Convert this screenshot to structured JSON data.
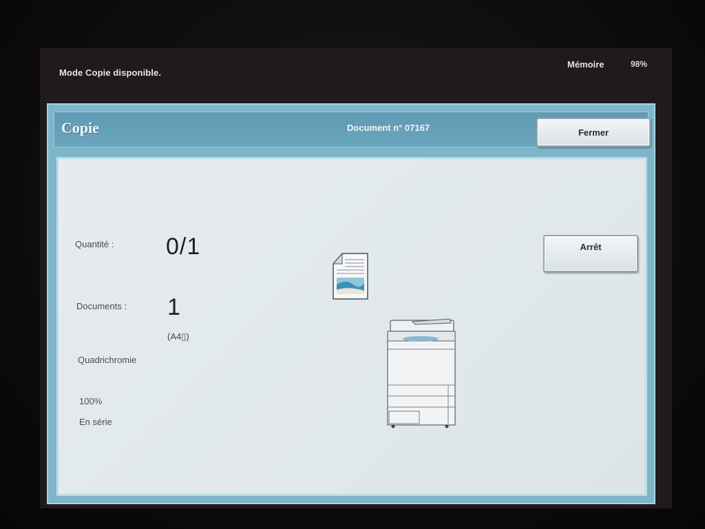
{
  "status": {
    "message": "Mode Copie disponible."
  },
  "memory": {
    "label": "Mémoire",
    "value": "98%"
  },
  "window": {
    "title": "Copie",
    "document_number": "Document n° 07167",
    "close_label": "Fermer"
  },
  "job": {
    "quantity_label": "Quantité :",
    "quantity_value": "0/1",
    "documents_label": "Documents :",
    "documents_value": "1",
    "paper_size": "(A4▯)",
    "color_mode": "Quadrichromie",
    "zoom": "100%",
    "output_mode": "En série",
    "stop_label": "Arrêt"
  },
  "icons": [
    "document-icon",
    "copier-machine-icon"
  ],
  "colors": {
    "title_bar": "#6aa6bd",
    "panel_bg": "#e3e9eb",
    "frame": "#7fb5c9"
  }
}
